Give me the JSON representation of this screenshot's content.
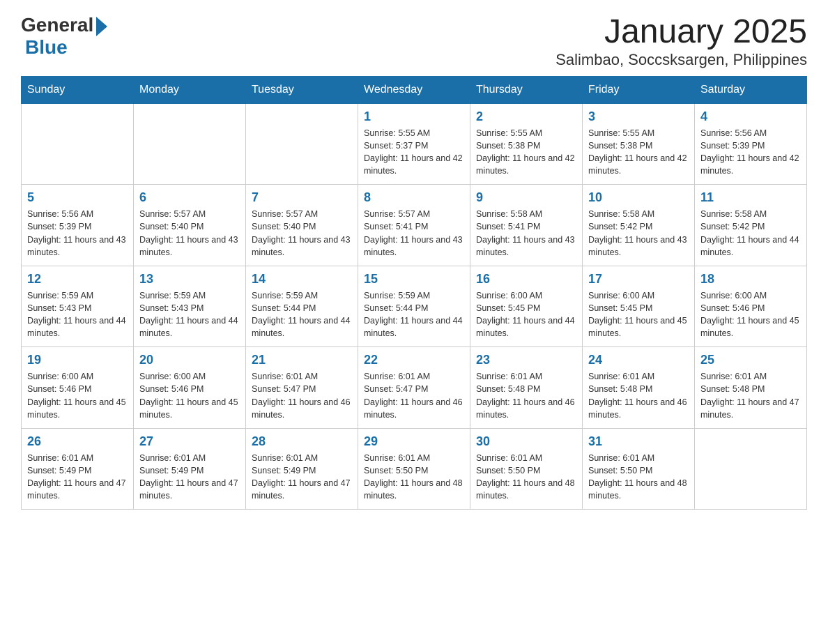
{
  "header": {
    "logo_general": "General",
    "logo_blue": "Blue",
    "month_title": "January 2025",
    "location": "Salimbao, Soccsksargen, Philippines"
  },
  "weekdays": [
    "Sunday",
    "Monday",
    "Tuesday",
    "Wednesday",
    "Thursday",
    "Friday",
    "Saturday"
  ],
  "weeks": [
    [
      {
        "day": "",
        "sunrise": "",
        "sunset": "",
        "daylight": ""
      },
      {
        "day": "",
        "sunrise": "",
        "sunset": "",
        "daylight": ""
      },
      {
        "day": "",
        "sunrise": "",
        "sunset": "",
        "daylight": ""
      },
      {
        "day": "1",
        "sunrise": "Sunrise: 5:55 AM",
        "sunset": "Sunset: 5:37 PM",
        "daylight": "Daylight: 11 hours and 42 minutes."
      },
      {
        "day": "2",
        "sunrise": "Sunrise: 5:55 AM",
        "sunset": "Sunset: 5:38 PM",
        "daylight": "Daylight: 11 hours and 42 minutes."
      },
      {
        "day": "3",
        "sunrise": "Sunrise: 5:55 AM",
        "sunset": "Sunset: 5:38 PM",
        "daylight": "Daylight: 11 hours and 42 minutes."
      },
      {
        "day": "4",
        "sunrise": "Sunrise: 5:56 AM",
        "sunset": "Sunset: 5:39 PM",
        "daylight": "Daylight: 11 hours and 42 minutes."
      }
    ],
    [
      {
        "day": "5",
        "sunrise": "Sunrise: 5:56 AM",
        "sunset": "Sunset: 5:39 PM",
        "daylight": "Daylight: 11 hours and 43 minutes."
      },
      {
        "day": "6",
        "sunrise": "Sunrise: 5:57 AM",
        "sunset": "Sunset: 5:40 PM",
        "daylight": "Daylight: 11 hours and 43 minutes."
      },
      {
        "day": "7",
        "sunrise": "Sunrise: 5:57 AM",
        "sunset": "Sunset: 5:40 PM",
        "daylight": "Daylight: 11 hours and 43 minutes."
      },
      {
        "day": "8",
        "sunrise": "Sunrise: 5:57 AM",
        "sunset": "Sunset: 5:41 PM",
        "daylight": "Daylight: 11 hours and 43 minutes."
      },
      {
        "day": "9",
        "sunrise": "Sunrise: 5:58 AM",
        "sunset": "Sunset: 5:41 PM",
        "daylight": "Daylight: 11 hours and 43 minutes."
      },
      {
        "day": "10",
        "sunrise": "Sunrise: 5:58 AM",
        "sunset": "Sunset: 5:42 PM",
        "daylight": "Daylight: 11 hours and 43 minutes."
      },
      {
        "day": "11",
        "sunrise": "Sunrise: 5:58 AM",
        "sunset": "Sunset: 5:42 PM",
        "daylight": "Daylight: 11 hours and 44 minutes."
      }
    ],
    [
      {
        "day": "12",
        "sunrise": "Sunrise: 5:59 AM",
        "sunset": "Sunset: 5:43 PM",
        "daylight": "Daylight: 11 hours and 44 minutes."
      },
      {
        "day": "13",
        "sunrise": "Sunrise: 5:59 AM",
        "sunset": "Sunset: 5:43 PM",
        "daylight": "Daylight: 11 hours and 44 minutes."
      },
      {
        "day": "14",
        "sunrise": "Sunrise: 5:59 AM",
        "sunset": "Sunset: 5:44 PM",
        "daylight": "Daylight: 11 hours and 44 minutes."
      },
      {
        "day": "15",
        "sunrise": "Sunrise: 5:59 AM",
        "sunset": "Sunset: 5:44 PM",
        "daylight": "Daylight: 11 hours and 44 minutes."
      },
      {
        "day": "16",
        "sunrise": "Sunrise: 6:00 AM",
        "sunset": "Sunset: 5:45 PM",
        "daylight": "Daylight: 11 hours and 44 minutes."
      },
      {
        "day": "17",
        "sunrise": "Sunrise: 6:00 AM",
        "sunset": "Sunset: 5:45 PM",
        "daylight": "Daylight: 11 hours and 45 minutes."
      },
      {
        "day": "18",
        "sunrise": "Sunrise: 6:00 AM",
        "sunset": "Sunset: 5:46 PM",
        "daylight": "Daylight: 11 hours and 45 minutes."
      }
    ],
    [
      {
        "day": "19",
        "sunrise": "Sunrise: 6:00 AM",
        "sunset": "Sunset: 5:46 PM",
        "daylight": "Daylight: 11 hours and 45 minutes."
      },
      {
        "day": "20",
        "sunrise": "Sunrise: 6:00 AM",
        "sunset": "Sunset: 5:46 PM",
        "daylight": "Daylight: 11 hours and 45 minutes."
      },
      {
        "day": "21",
        "sunrise": "Sunrise: 6:01 AM",
        "sunset": "Sunset: 5:47 PM",
        "daylight": "Daylight: 11 hours and 46 minutes."
      },
      {
        "day": "22",
        "sunrise": "Sunrise: 6:01 AM",
        "sunset": "Sunset: 5:47 PM",
        "daylight": "Daylight: 11 hours and 46 minutes."
      },
      {
        "day": "23",
        "sunrise": "Sunrise: 6:01 AM",
        "sunset": "Sunset: 5:48 PM",
        "daylight": "Daylight: 11 hours and 46 minutes."
      },
      {
        "day": "24",
        "sunrise": "Sunrise: 6:01 AM",
        "sunset": "Sunset: 5:48 PM",
        "daylight": "Daylight: 11 hours and 46 minutes."
      },
      {
        "day": "25",
        "sunrise": "Sunrise: 6:01 AM",
        "sunset": "Sunset: 5:48 PM",
        "daylight": "Daylight: 11 hours and 47 minutes."
      }
    ],
    [
      {
        "day": "26",
        "sunrise": "Sunrise: 6:01 AM",
        "sunset": "Sunset: 5:49 PM",
        "daylight": "Daylight: 11 hours and 47 minutes."
      },
      {
        "day": "27",
        "sunrise": "Sunrise: 6:01 AM",
        "sunset": "Sunset: 5:49 PM",
        "daylight": "Daylight: 11 hours and 47 minutes."
      },
      {
        "day": "28",
        "sunrise": "Sunrise: 6:01 AM",
        "sunset": "Sunset: 5:49 PM",
        "daylight": "Daylight: 11 hours and 47 minutes."
      },
      {
        "day": "29",
        "sunrise": "Sunrise: 6:01 AM",
        "sunset": "Sunset: 5:50 PM",
        "daylight": "Daylight: 11 hours and 48 minutes."
      },
      {
        "day": "30",
        "sunrise": "Sunrise: 6:01 AM",
        "sunset": "Sunset: 5:50 PM",
        "daylight": "Daylight: 11 hours and 48 minutes."
      },
      {
        "day": "31",
        "sunrise": "Sunrise: 6:01 AM",
        "sunset": "Sunset: 5:50 PM",
        "daylight": "Daylight: 11 hours and 48 minutes."
      },
      {
        "day": "",
        "sunrise": "",
        "sunset": "",
        "daylight": ""
      }
    ]
  ]
}
